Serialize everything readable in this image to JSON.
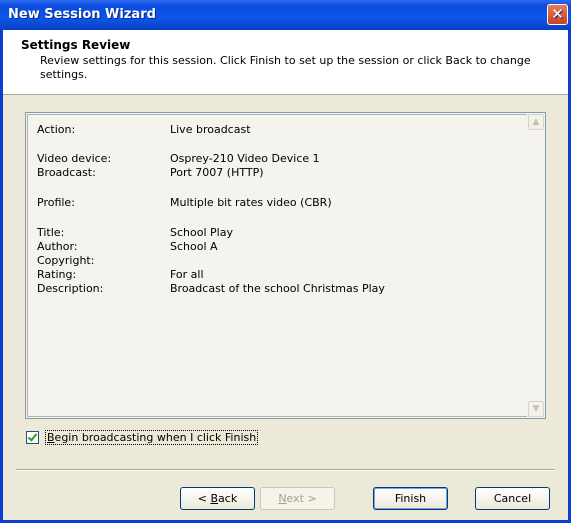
{
  "window": {
    "title": "New Session Wizard",
    "close_glyph": "✕"
  },
  "header": {
    "title": "Settings Review",
    "description": "Review settings for this session. Click Finish to set up the session or click Back to change settings."
  },
  "settings": {
    "action": {
      "label": "Action:",
      "value": "Live broadcast"
    },
    "video_device": {
      "label": "Video device:",
      "value": "Osprey-210 Video Device 1"
    },
    "broadcast": {
      "label": "Broadcast:",
      "value": "Port 7007 (HTTP)"
    },
    "profile": {
      "label": "Profile:",
      "value": "Multiple bit rates video (CBR)"
    },
    "title": {
      "label": "Title:",
      "value": "School Play"
    },
    "author": {
      "label": "Author:",
      "value": "School A"
    },
    "copyright": {
      "label": "Copyright:",
      "value": ""
    },
    "rating": {
      "label": "Rating:",
      "value": "For all"
    },
    "description": {
      "label": "Description:",
      "value": "Broadcast of the school Christmas Play"
    }
  },
  "scroll": {
    "up_glyph": "▲",
    "down_glyph": "▼"
  },
  "begin_checkbox": {
    "label_first": "B",
    "label_rest": "egin broadcasting when I click Finish",
    "checked": true
  },
  "buttons": {
    "back_prefix": "< ",
    "back_mnemonic": "B",
    "back_rest": "ack",
    "next_mnemonic": "N",
    "next_rest": "ext >",
    "finish": "Finish",
    "cancel": "Cancel"
  }
}
